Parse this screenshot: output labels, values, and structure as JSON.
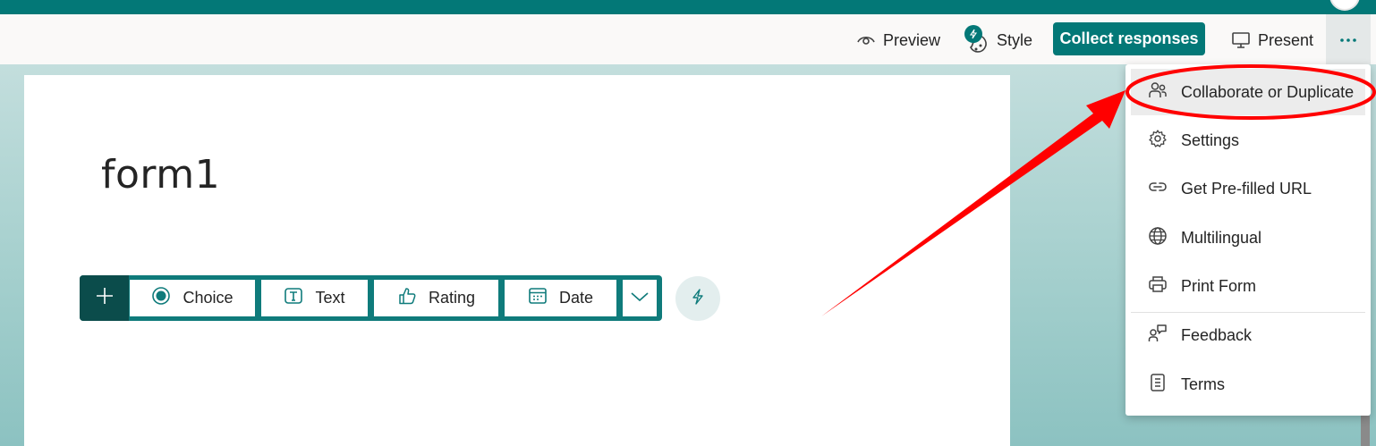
{
  "toolbar": {
    "preview_label": "Preview",
    "style_label": "Style",
    "collect_label": "Collect responses",
    "present_label": "Present",
    "more_label": "···"
  },
  "form": {
    "title": "form1"
  },
  "question_bar": {
    "add_label": "+",
    "types": [
      {
        "label": "Choice",
        "icon": "radio-icon"
      },
      {
        "label": "Text",
        "icon": "text-icon"
      },
      {
        "label": "Rating",
        "icon": "thumbs-up-icon"
      },
      {
        "label": "Date",
        "icon": "calendar-icon"
      }
    ],
    "more_types_icon": "chevron-down-icon",
    "quick_start_icon": "lightning-icon"
  },
  "menu": {
    "items": [
      {
        "label": "Collaborate or Duplicate",
        "icon": "people-icon",
        "highlighted": true
      },
      {
        "label": "Settings",
        "icon": "gear-icon"
      },
      {
        "label": "Get Pre-filled URL",
        "icon": "link-icon"
      },
      {
        "label": "Multilingual",
        "icon": "globe-icon"
      },
      {
        "label": "Print Form",
        "icon": "printer-icon"
      },
      {
        "label": "Feedback",
        "icon": "feedback-icon"
      },
      {
        "label": "Terms",
        "icon": "document-icon"
      }
    ]
  },
  "colors": {
    "brand": "#037877",
    "brand_dark": "#0b4c4b",
    "annotation": "#ff0000",
    "menu_highlight": "#ececec"
  }
}
